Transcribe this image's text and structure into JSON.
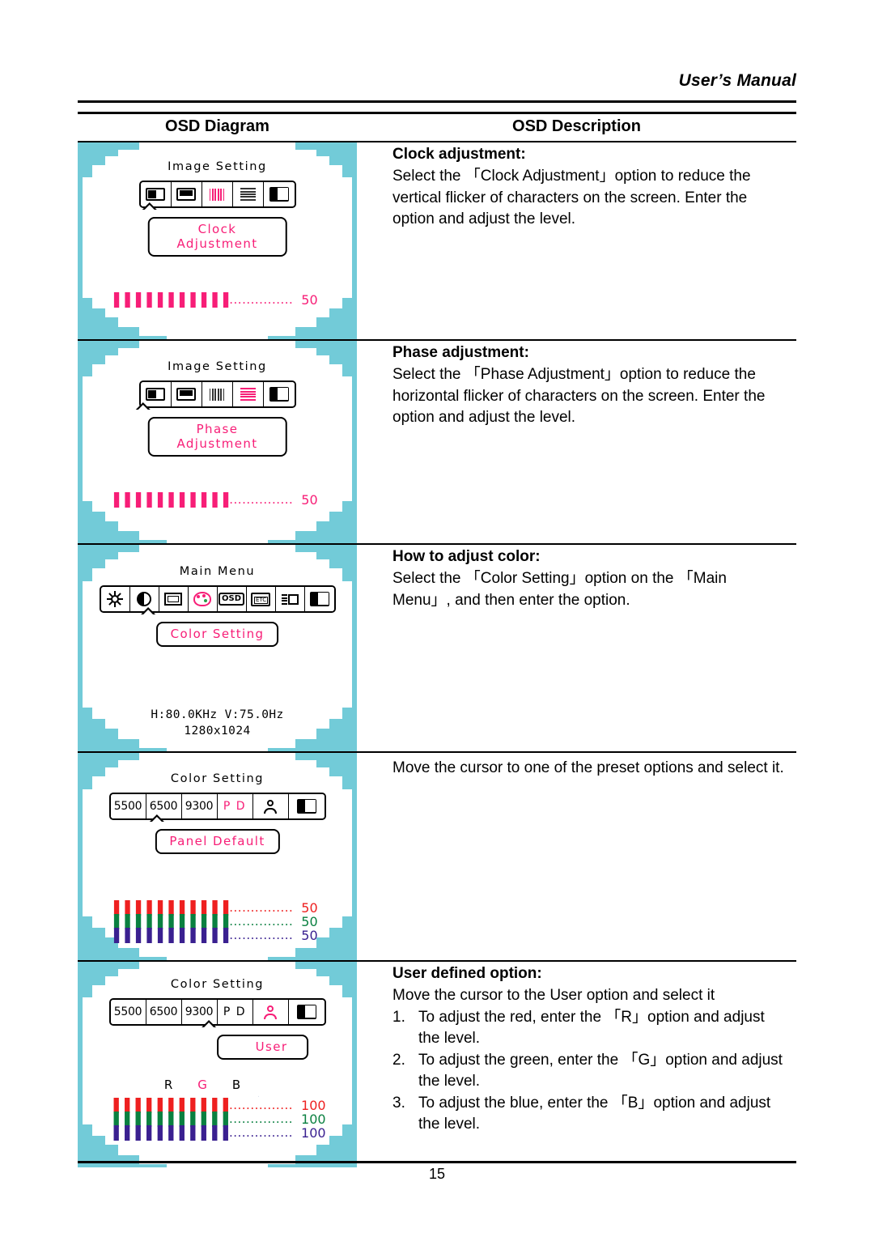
{
  "header": {
    "manual_title": "User’s Manual"
  },
  "table": {
    "col1_header": "OSD Diagram",
    "col2_header": "OSD Description"
  },
  "rows": [
    {
      "diagram": {
        "title": "Image Setting",
        "icons": [
          "h-position-icon",
          "v-position-icon",
          "clock-icon",
          "phase-icon",
          "exit-icon"
        ],
        "selected_index": 2,
        "label": "Clock Adjustment",
        "sliders": [
          {
            "value": "50",
            "color": "#f71e77"
          }
        ]
      },
      "desc": {
        "title": "Clock adjustment:",
        "body": "Select the 「Clock Adjustment」option to reduce the vertical flicker of characters on the screen. Enter the option and adjust the level."
      }
    },
    {
      "diagram": {
        "title": "Image Setting",
        "icons": [
          "h-position-icon",
          "v-position-icon",
          "clock-icon",
          "phase-icon",
          "exit-icon"
        ],
        "selected_index": 3,
        "label": "Phase Adjustment",
        "sliders": [
          {
            "value": "50",
            "color": "#f71e77"
          }
        ]
      },
      "desc": {
        "title": "Phase adjustment:",
        "body": "Select the 「Phase Adjustment」option to reduce the horizontal flicker of characters on the screen. Enter the option and adjust the level."
      }
    },
    {
      "diagram": {
        "title": "Main Menu",
        "icons": [
          "brightness-icon",
          "contrast-icon",
          "image-size-icon",
          "color-palette-icon",
          "osd-icon",
          "etc-icon",
          "information-icon",
          "exit-icon"
        ],
        "selected_index": 3,
        "label": "Color Setting",
        "freq_line1": "H:80.0KHz V:75.0Hz",
        "freq_line2": "1280x1024"
      },
      "desc": {
        "title": "How to adjust color:",
        "body": "Select the 「Color Setting」option on the 「Main Menu」, and then enter the option."
      }
    },
    {
      "diagram": {
        "title": "Color Setting",
        "preset_labels": [
          "5500",
          "6500",
          "9300",
          "P D"
        ],
        "icons": [
          "user-icon",
          "exit-icon"
        ],
        "selected_index": 3,
        "label": "Panel Default",
        "sliders": [
          {
            "value": "50",
            "color": "#ee2020"
          },
          {
            "value": "50",
            "color": "#0a8040"
          },
          {
            "value": "50",
            "color": "#3a2090"
          }
        ]
      },
      "desc": {
        "title": "",
        "body": "Move the cursor to one of the preset options and select it."
      }
    },
    {
      "diagram": {
        "title": "Color Setting",
        "preset_labels": [
          "5500",
          "6500",
          "9300",
          "P D"
        ],
        "icons": [
          "user-icon",
          "exit-icon"
        ],
        "selected_index": 4,
        "label": "User",
        "rgb_heads": [
          "R",
          "G",
          "B"
        ],
        "rgb_selected_index": 1,
        "sliders": [
          {
            "value": "100",
            "color": "#ee2020"
          },
          {
            "value": "100",
            "color": "#0a8040"
          },
          {
            "value": "100",
            "color": "#3a2090"
          }
        ]
      },
      "desc": {
        "title": "User defined option:",
        "body": "Move the cursor to the User option and select it",
        "list": [
          {
            "num": "1.",
            "text": "To adjust the red, enter the 「R」option and adjust the level."
          },
          {
            "num": "2.",
            "text": "To adjust the green, enter the 「G」option and adjust the level."
          },
          {
            "num": "3.",
            "text": "To adjust the blue, enter the 「B」option and adjust the level."
          }
        ]
      }
    }
  ],
  "footer": {
    "page_number": "15"
  },
  "colors": {
    "osd_background": "#72cbd8",
    "accent_pink": "#f71e77",
    "red": "#ee2020",
    "green": "#0a8040",
    "blue": "#3a2090"
  },
  "slider": {
    "ticks": "▌▌▌▌▌▌▌▌▌▌▌▌",
    "dots": "...............​"
  }
}
